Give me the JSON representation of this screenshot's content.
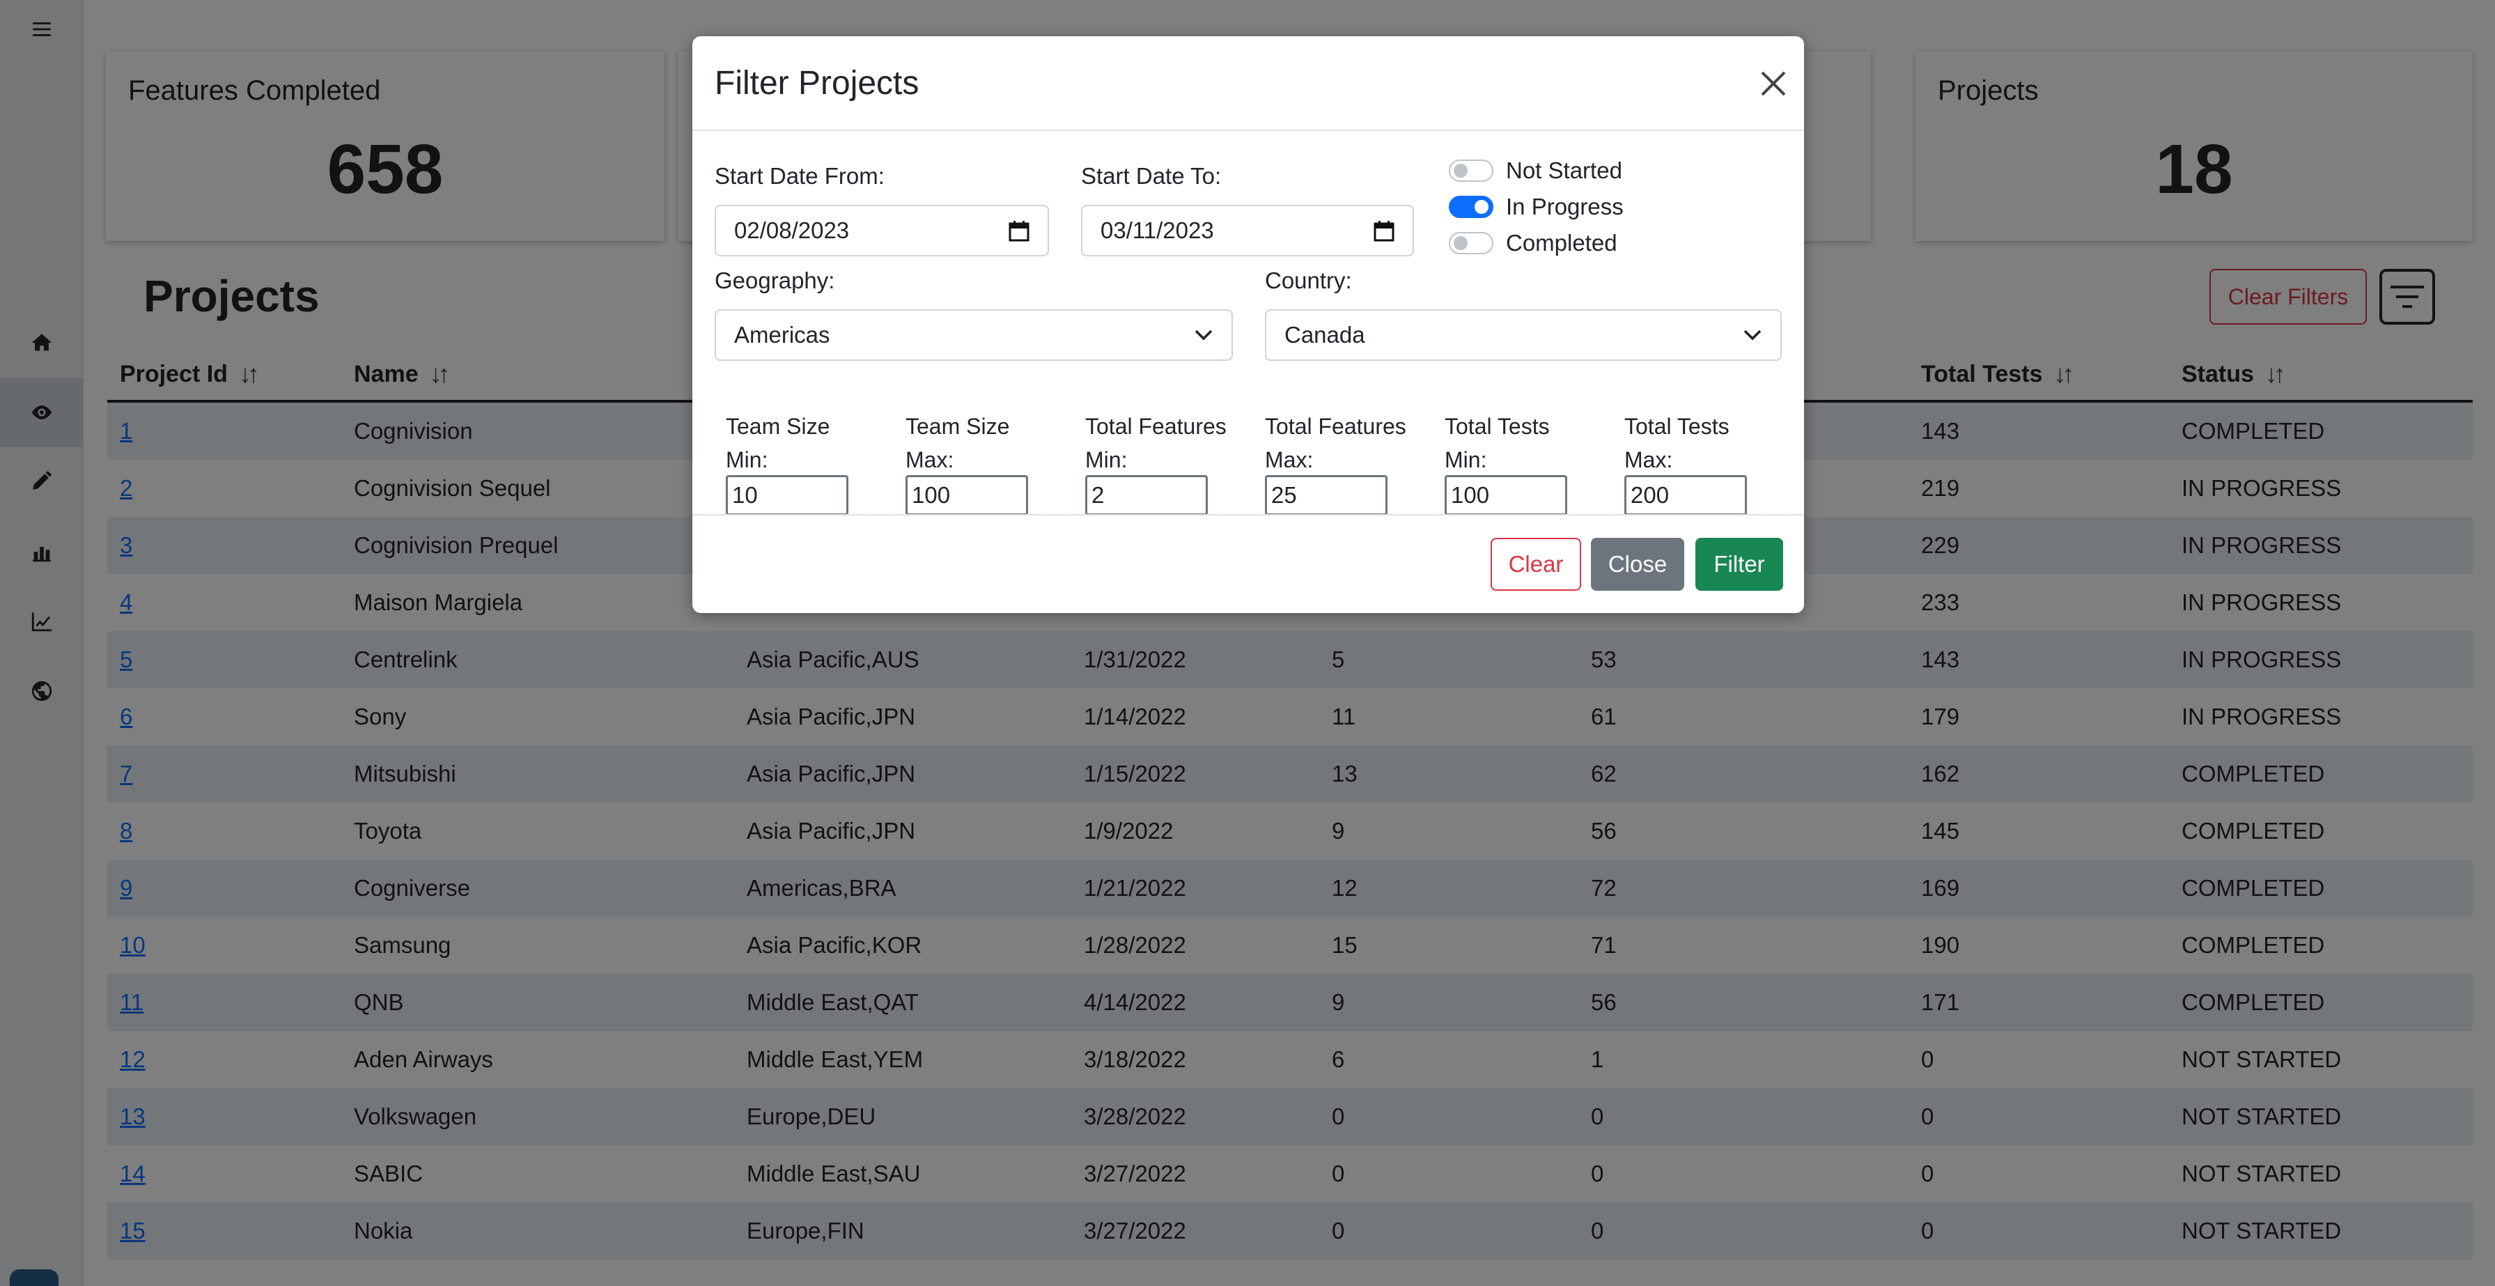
{
  "cards": [
    {
      "title": "Features Completed",
      "value": "658"
    },
    {
      "title": "Projects",
      "value": "18"
    }
  ],
  "page": {
    "title": "Projects",
    "clear_filters_label": "Clear Filters"
  },
  "sidebar": {
    "icons": [
      "menu-icon",
      "home-icon",
      "eye-icon",
      "pencil-icon",
      "bar-chart-icon",
      "line-chart-icon",
      "globe-icon"
    ]
  },
  "table": {
    "headers": [
      "Project Id",
      "Name",
      "",
      "",
      "",
      "",
      "Total Tests",
      "Status"
    ],
    "rows": [
      {
        "id": "1",
        "name": "Cognivision",
        "geo": "",
        "date": "",
        "features": "",
        "completed": "",
        "tests": "143",
        "status": "COMPLETED"
      },
      {
        "id": "2",
        "name": "Cognivision Sequel",
        "geo": "",
        "date": "",
        "features": "",
        "completed": "",
        "tests": "219",
        "status": "IN PROGRESS"
      },
      {
        "id": "3",
        "name": "Cognivision Prequel",
        "geo": "",
        "date": "",
        "features": "",
        "completed": "",
        "tests": "229",
        "status": "IN PROGRESS"
      },
      {
        "id": "4",
        "name": "Maison Margiela",
        "geo": "",
        "date": "",
        "features": "",
        "completed": "",
        "tests": "233",
        "status": "IN PROGRESS"
      },
      {
        "id": "5",
        "name": "Centrelink",
        "geo": "Asia Pacific,AUS",
        "date": "1/31/2022",
        "features": "5",
        "completed": "53",
        "tests": "143",
        "status": "IN PROGRESS"
      },
      {
        "id": "6",
        "name": "Sony",
        "geo": "Asia Pacific,JPN",
        "date": "1/14/2022",
        "features": "11",
        "completed": "61",
        "tests": "179",
        "status": "IN PROGRESS"
      },
      {
        "id": "7",
        "name": "Mitsubishi",
        "geo": "Asia Pacific,JPN",
        "date": "1/15/2022",
        "features": "13",
        "completed": "62",
        "tests": "162",
        "status": "COMPLETED"
      },
      {
        "id": "8",
        "name": "Toyota",
        "geo": "Asia Pacific,JPN",
        "date": "1/9/2022",
        "features": "9",
        "completed": "56",
        "tests": "145",
        "status": "COMPLETED"
      },
      {
        "id": "9",
        "name": "Cogniverse",
        "geo": "Americas,BRA",
        "date": "1/21/2022",
        "features": "12",
        "completed": "72",
        "tests": "169",
        "status": "COMPLETED"
      },
      {
        "id": "10",
        "name": "Samsung",
        "geo": "Asia Pacific,KOR",
        "date": "1/28/2022",
        "features": "15",
        "completed": "71",
        "tests": "190",
        "status": "COMPLETED"
      },
      {
        "id": "11",
        "name": "QNB",
        "geo": "Middle East,QAT",
        "date": "4/14/2022",
        "features": "9",
        "completed": "56",
        "tests": "171",
        "status": "COMPLETED"
      },
      {
        "id": "12",
        "name": "Aden Airways",
        "geo": "Middle East,YEM",
        "date": "3/18/2022",
        "features": "6",
        "completed": "1",
        "tests": "0",
        "status": "NOT STARTED"
      },
      {
        "id": "13",
        "name": "Volkswagen",
        "geo": "Europe,DEU",
        "date": "3/28/2022",
        "features": "0",
        "completed": "0",
        "tests": "0",
        "status": "NOT STARTED"
      },
      {
        "id": "14",
        "name": "SABIC",
        "geo": "Middle East,SAU",
        "date": "3/27/2022",
        "features": "0",
        "completed": "0",
        "tests": "0",
        "status": "NOT STARTED"
      },
      {
        "id": "15",
        "name": "Nokia",
        "geo": "Europe,FIN",
        "date": "3/27/2022",
        "features": "0",
        "completed": "0",
        "tests": "0",
        "status": "NOT STARTED"
      }
    ]
  },
  "modal": {
    "title": "Filter Projects",
    "start_from_label": "Start Date From:",
    "start_from_value": "02/08/2023",
    "start_to_label": "Start Date To:",
    "start_to_value": "03/11/2023",
    "status_switches": [
      {
        "label": "Not Started",
        "on": false
      },
      {
        "label": "In Progress",
        "on": true
      },
      {
        "label": "Completed",
        "on": false
      }
    ],
    "geography_label": "Geography:",
    "geography_value": "Americas",
    "country_label": "Country:",
    "country_value": "Canada",
    "ranges": [
      {
        "label": "Team Size Min:",
        "value": "10"
      },
      {
        "label": "Team Size Max:",
        "value": "100"
      },
      {
        "label": "Total Features Min:",
        "value": "2"
      },
      {
        "label": "Total Features Max:",
        "value": "25"
      },
      {
        "label": "Total Tests Min:",
        "value": "100"
      },
      {
        "label": "Total Tests Max:",
        "value": "200"
      }
    ],
    "buttons": {
      "clear": "Clear",
      "close": "Close",
      "filter": "Filter"
    }
  },
  "colors": {
    "primary": "#0d6efd",
    "danger": "#dc3545",
    "success": "#198754",
    "secondary": "#6c757d",
    "row_stripe": "#e8eef3"
  }
}
